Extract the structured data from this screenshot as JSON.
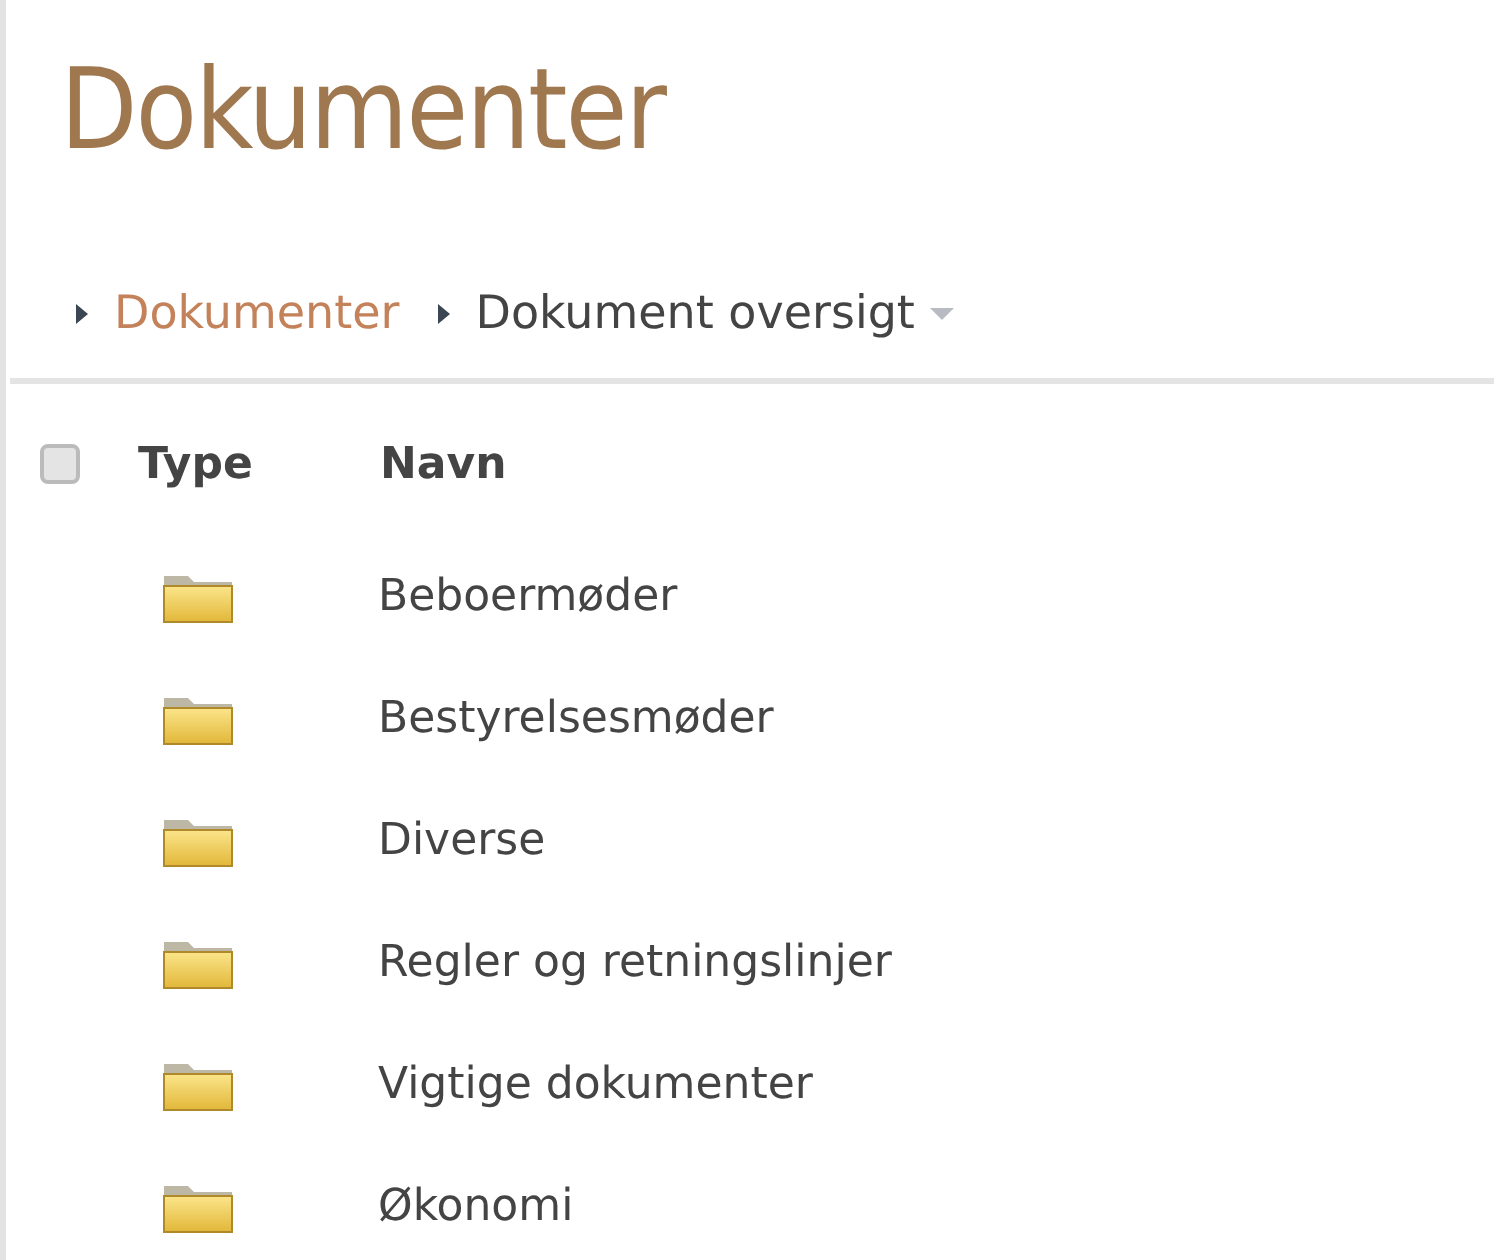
{
  "title": "Dokumenter",
  "breadcrumb": [
    {
      "label": "Dokumenter",
      "kind": "link"
    },
    {
      "label": "Dokument oversigt",
      "kind": "current"
    }
  ],
  "table": {
    "select_all": {
      "checked": false
    },
    "columns": [
      "Type",
      "Navn"
    ],
    "rows": [
      {
        "kind": "folder",
        "name": "Beboermøder"
      },
      {
        "kind": "folder",
        "name": "Bestyrelsesmøder"
      },
      {
        "kind": "folder",
        "name": "Diverse"
      },
      {
        "kind": "folder",
        "name": "Regler og retningslinjer"
      },
      {
        "kind": "folder",
        "name": "Vigtige dokumenter"
      },
      {
        "kind": "folder",
        "name": "Økonomi"
      }
    ]
  }
}
